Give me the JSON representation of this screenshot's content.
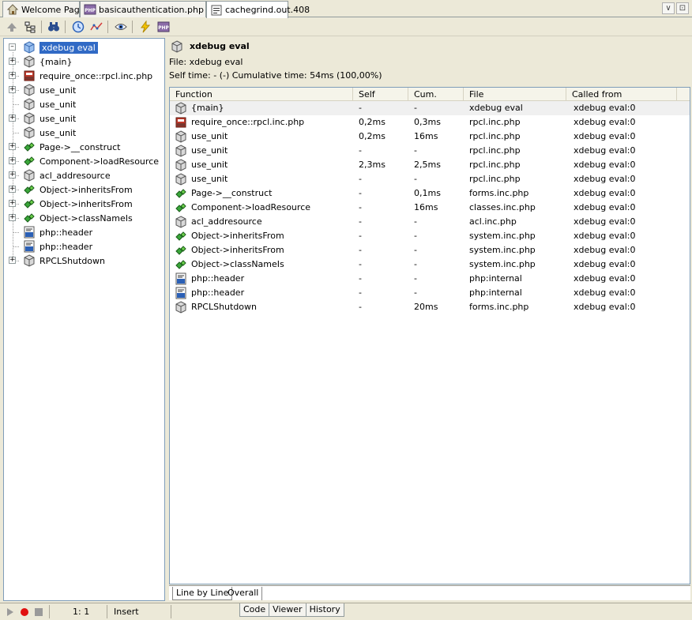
{
  "tabs": [
    {
      "label": "Welcome Page",
      "icon": "home-icon"
    },
    {
      "label": "basicauthentication.php",
      "icon": "php-file-icon"
    },
    {
      "label": "cachegrind.out.408",
      "icon": "cachegrind-file-icon"
    }
  ],
  "tree": {
    "root": "xdebug eval",
    "items": [
      {
        "label": "{main}",
        "icon": "cube-icon",
        "expandable": true
      },
      {
        "label": "require_once::rpcl.inc.php",
        "icon": "require-icon",
        "expandable": true
      },
      {
        "label": "use_unit",
        "icon": "cube-icon",
        "expandable": true
      },
      {
        "label": "use_unit",
        "icon": "cube-icon",
        "expandable": false
      },
      {
        "label": "use_unit",
        "icon": "cube-icon",
        "expandable": true
      },
      {
        "label": "use_unit",
        "icon": "cube-icon",
        "expandable": false
      },
      {
        "label": "Page->__construct",
        "icon": "method-icon",
        "expandable": true
      },
      {
        "label": "Component->loadResource",
        "icon": "method-icon",
        "expandable": true
      },
      {
        "label": "acl_addresource",
        "icon": "cube-icon",
        "expandable": true
      },
      {
        "label": "Object->inheritsFrom",
        "icon": "method-icon",
        "expandable": true
      },
      {
        "label": "Object->inheritsFrom",
        "icon": "method-icon",
        "expandable": true
      },
      {
        "label": "Object->classNameIs",
        "icon": "method-icon",
        "expandable": true
      },
      {
        "label": "php::header",
        "icon": "php-internal-icon",
        "expandable": false
      },
      {
        "label": "php::header",
        "icon": "php-internal-icon",
        "expandable": false
      },
      {
        "label": "RPCLShutdown",
        "icon": "cube-icon",
        "expandable": true
      }
    ]
  },
  "details": {
    "title": "xdebug eval",
    "file_line": "File:  xdebug eval",
    "time_line": "Self time: - (-)  Cumulative time: 54ms (100,00%)"
  },
  "table": {
    "columns": [
      "Function",
      "Self",
      "Cum.",
      "File",
      "Called from"
    ],
    "rows": [
      {
        "fn": "{main}",
        "icon": "cube-icon",
        "self": "-",
        "cum": "-",
        "file": "xdebug eval",
        "called": "xdebug eval:0"
      },
      {
        "fn": "require_once::rpcl.inc.php",
        "icon": "require-icon",
        "self": "0,2ms",
        "cum": "0,3ms",
        "file": "rpcl.inc.php",
        "called": "xdebug eval:0"
      },
      {
        "fn": "use_unit",
        "icon": "cube-icon",
        "self": "0,2ms",
        "cum": "16ms",
        "file": "rpcl.inc.php",
        "called": "xdebug eval:0"
      },
      {
        "fn": "use_unit",
        "icon": "cube-icon",
        "self": "-",
        "cum": "-",
        "file": "rpcl.inc.php",
        "called": "xdebug eval:0"
      },
      {
        "fn": "use_unit",
        "icon": "cube-icon",
        "self": "2,3ms",
        "cum": "2,5ms",
        "file": "rpcl.inc.php",
        "called": "xdebug eval:0"
      },
      {
        "fn": "use_unit",
        "icon": "cube-icon",
        "self": "-",
        "cum": "-",
        "file": "rpcl.inc.php",
        "called": "xdebug eval:0"
      },
      {
        "fn": "Page->__construct",
        "icon": "method-icon",
        "self": "-",
        "cum": "0,1ms",
        "file": "forms.inc.php",
        "called": "xdebug eval:0"
      },
      {
        "fn": "Component->loadResource",
        "icon": "method-icon",
        "self": "-",
        "cum": "16ms",
        "file": "classes.inc.php",
        "called": "xdebug eval:0"
      },
      {
        "fn": "acl_addresource",
        "icon": "cube-icon",
        "self": "-",
        "cum": "-",
        "file": "acl.inc.php",
        "called": "xdebug eval:0"
      },
      {
        "fn": "Object->inheritsFrom",
        "icon": "method-icon",
        "self": "-",
        "cum": "-",
        "file": "system.inc.php",
        "called": "xdebug eval:0"
      },
      {
        "fn": "Object->inheritsFrom",
        "icon": "method-icon",
        "self": "-",
        "cum": "-",
        "file": "system.inc.php",
        "called": "xdebug eval:0"
      },
      {
        "fn": "Object->classNameIs",
        "icon": "method-icon",
        "self": "-",
        "cum": "-",
        "file": "system.inc.php",
        "called": "xdebug eval:0"
      },
      {
        "fn": "php::header",
        "icon": "php-internal-icon",
        "self": "-",
        "cum": "-",
        "file": "php:internal",
        "called": "xdebug eval:0"
      },
      {
        "fn": "php::header",
        "icon": "php-internal-icon",
        "self": "-",
        "cum": "-",
        "file": "php:internal",
        "called": "xdebug eval:0"
      },
      {
        "fn": "RPCLShutdown",
        "icon": "cube-icon",
        "self": "-",
        "cum": "20ms",
        "file": "forms.inc.php",
        "called": "xdebug eval:0"
      }
    ]
  },
  "subtabs": [
    "Line by Line",
    "Overall"
  ],
  "status": {
    "position": "1: 1",
    "mode": "Insert",
    "bottom_tabs": [
      "Code",
      "Viewer",
      "History"
    ]
  },
  "colors": {
    "selection": "#316ac5",
    "accent": "#316ac5"
  }
}
